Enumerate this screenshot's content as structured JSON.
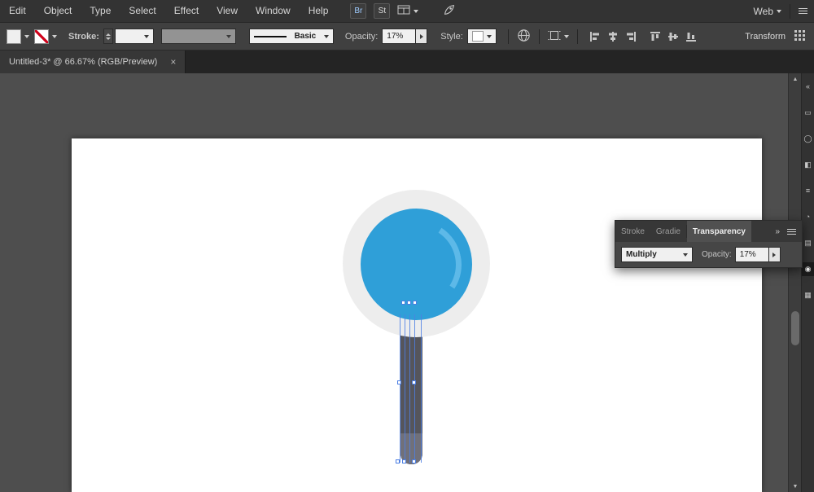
{
  "menu_bar": {
    "items": [
      "Edit",
      "Object",
      "Type",
      "Select",
      "Effect",
      "View",
      "Window",
      "Help"
    ],
    "bridge_label": "Br",
    "stock_label": "St",
    "workspace_label": "Web"
  },
  "control_bar": {
    "stroke_label": "Stroke:",
    "brush_name": "Basic",
    "opacity_label": "Opacity:",
    "opacity_value": "17%",
    "style_label": "Style:",
    "transform_label": "Transform"
  },
  "document_tab": {
    "title": "Untitled-3* @ 66.67% (RGB/Preview)",
    "close_glyph": "×"
  },
  "transparency_panel": {
    "tabs": [
      "Stroke",
      "Gradie",
      "Transparency"
    ],
    "active_tab": "Transparency",
    "blend_mode": "Multiply",
    "opacity_label": "Opacity:",
    "opacity_value": "17%",
    "collapse_glyph": "»"
  },
  "icons": {
    "dock": [
      "«",
      "▭",
      "◯",
      "◧",
      "≡",
      "◔",
      "▤",
      "◉",
      "▦"
    ],
    "scroll_up": "▲",
    "scroll_down": "▼"
  },
  "colors": {
    "accent_blue": "#2f9fd8",
    "highlight_blue": "#5db9e8",
    "ring_gray": "#ededed",
    "stem_gray": "#55555b",
    "stem_tip_gray": "#70707a",
    "selection_blue": "#4d7fe3"
  }
}
